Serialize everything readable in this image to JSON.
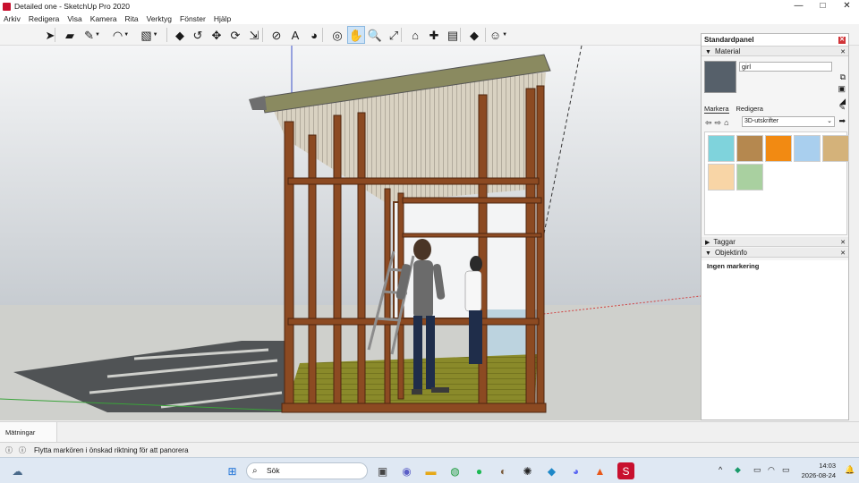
{
  "window": {
    "title": "Detailed one - SketchUp Pro 2020",
    "controls": {
      "minimize": "—",
      "maximize": "□",
      "close": "✕"
    }
  },
  "menu": [
    "Arkiv",
    "Redigera",
    "Visa",
    "Kamera",
    "Rita",
    "Verktyg",
    "Fönster",
    "Hjälp"
  ],
  "toolbar": {
    "tools": [
      {
        "name": "select-tool",
        "icon": "arrow-icon",
        "glyph": "➤",
        "active": false
      },
      {
        "name": "eraser-tool",
        "icon": "eraser-icon",
        "glyph": "▰",
        "active": false
      },
      {
        "name": "line-tool",
        "icon": "pencil-icon",
        "glyph": "✎",
        "active": false
      },
      {
        "name": "arc-tool",
        "icon": "arc-icon",
        "glyph": "◠",
        "active": false
      },
      {
        "name": "rectangle-tool",
        "icon": "rectangle-icon",
        "glyph": "▧",
        "active": false
      },
      {
        "name": "push-pull-tool",
        "icon": "pushpull-icon",
        "glyph": "◆",
        "active": false
      },
      {
        "name": "offset-tool",
        "icon": "offset-icon",
        "glyph": "↺",
        "active": false
      },
      {
        "name": "move-tool",
        "icon": "move-icon",
        "glyph": "✥",
        "active": false
      },
      {
        "name": "rotate-tool",
        "icon": "rotate-icon",
        "glyph": "⟳",
        "active": false
      },
      {
        "name": "scale-tool",
        "icon": "scale-icon",
        "glyph": "⇲",
        "active": false
      },
      {
        "name": "tape-measure-tool",
        "icon": "tape-icon",
        "glyph": "⊘",
        "active": false
      },
      {
        "name": "text-tool",
        "icon": "text-icon",
        "glyph": "A",
        "active": false
      },
      {
        "name": "paint-bucket-tool",
        "icon": "paint-bucket-icon",
        "glyph": "◕",
        "active": false
      },
      {
        "name": "orbit-tool",
        "icon": "orbit-icon",
        "glyph": "◎",
        "active": false
      },
      {
        "name": "pan-tool",
        "icon": "hand-icon",
        "glyph": "✋",
        "active": true
      },
      {
        "name": "zoom-tool",
        "icon": "magnifier-icon",
        "glyph": "🔍",
        "active": false
      },
      {
        "name": "zoom-extents-tool",
        "icon": "zoom-extents-icon",
        "glyph": "⤢",
        "active": false
      },
      {
        "name": "warehouse-button",
        "icon": "warehouse-icon",
        "glyph": "⌂",
        "active": false
      },
      {
        "name": "extension-warehouse-button",
        "icon": "extension-icon",
        "glyph": "✚",
        "active": false
      },
      {
        "name": "send-to-layout-button",
        "icon": "layout-icon",
        "glyph": "▤",
        "active": false
      },
      {
        "name": "extension-manager-button",
        "icon": "ruby-icon",
        "glyph": "◆",
        "active": false
      },
      {
        "name": "profile-button",
        "icon": "profile-icon",
        "glyph": "☺",
        "active": false
      }
    ]
  },
  "panel": {
    "title": "Standardpanel",
    "material_section": "Material",
    "material_name": "girl",
    "tab_select": "Markera",
    "tab_edit": "Redigera",
    "collection": "3D-utskrifter",
    "swatches": [
      "#7fd3dc",
      "#b5884f",
      "#f28a12",
      "#a9cfee",
      "#d4b27a",
      "#f8d5a6",
      "#a9d0a0"
    ],
    "tags_section": "Taggar",
    "entity_info_section": "Objektinfo",
    "entity_info_text": "Ingen markering"
  },
  "measurements": {
    "label": "Mätningar",
    "value": ""
  },
  "status": {
    "message": "Flytta markören i önskad riktning för att panorera"
  },
  "taskbar": {
    "search_placeholder": "Sök",
    "time": "14:03",
    "date": "2026-08-24"
  }
}
